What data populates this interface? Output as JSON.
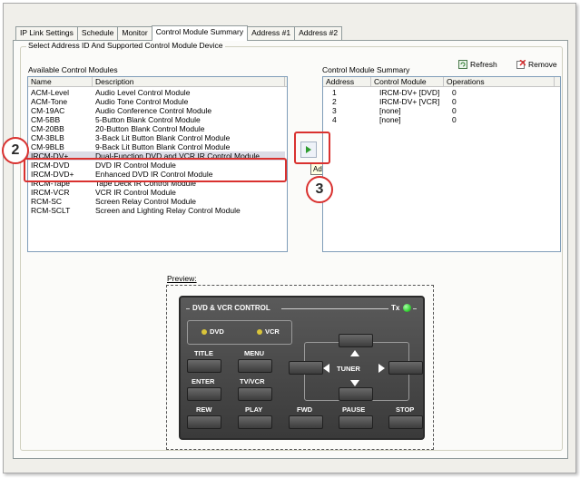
{
  "tabs": [
    "IP Link Settings",
    "Schedule",
    "Monitor",
    "Control Module Summary",
    "Address #1",
    "Address #2"
  ],
  "active_tab": "Control Module Summary",
  "group_title": "Select Address ID And Supported Control Module Device",
  "available": {
    "label": "Available Control Modules",
    "columns": [
      "Name",
      "Description"
    ],
    "rows": [
      [
        "ACM-Level",
        "Audio Level Control Module"
      ],
      [
        "ACM-Tone",
        "Audio Tone Control Module"
      ],
      [
        "CM-19AC",
        "Audio Conference Control Module"
      ],
      [
        "CM-5BB",
        "5-Button Blank Control Module"
      ],
      [
        "CM-20BB",
        "20-Button Blank Control Module"
      ],
      [
        "CM-3BLB",
        "3-Back Lit Button Blank Control Module"
      ],
      [
        "CM-9BLB",
        "9-Back Lit Button Blank Control Module"
      ],
      [
        "IRCM-DV+",
        "Dual-Function DVD and VCR IR Control Module"
      ],
      [
        "IRCM-DVD",
        "DVD IR Control Module"
      ],
      [
        "IRCM-DVD+",
        "Enhanced DVD IR Control Module"
      ],
      [
        "IRCM-Tape",
        "Tape Deck IR Control Module"
      ],
      [
        "IRCM-VCR",
        "VCR IR Control Module"
      ],
      [
        "RCM-SC",
        "Screen Relay Control Module"
      ],
      [
        "RCM-SCLT",
        "Screen and Lighting Relay Control Module"
      ]
    ]
  },
  "add_tooltip": "Add",
  "summary": {
    "label": "Control Module Summary",
    "refresh_label": "Refresh",
    "remove_label": "Remove",
    "columns": [
      "Address",
      "Control Module",
      "Operations"
    ],
    "rows": [
      [
        "1",
        "IRCM-DV+ [DVD]",
        "0"
      ],
      [
        "2",
        "IRCM-DV+ [VCR]",
        "0"
      ],
      [
        "3",
        "[none]",
        "0"
      ],
      [
        "4",
        "[none]",
        "0"
      ]
    ]
  },
  "callouts": [
    "2",
    "3"
  ],
  "preview": {
    "label": "Preview:",
    "panel_title": "DVD & VCR CONTROL",
    "tx_label": "Tx",
    "dvd_label": "DVD",
    "vcr_label": "VCR",
    "tuner_label": "TUNER",
    "buttons": [
      "TITLE",
      "MENU",
      "ENTER",
      "TV/VCR",
      "REW",
      "PLAY",
      "FWD",
      "PAUSE",
      "STOP"
    ]
  },
  "colors": {
    "callout": "#d9312f",
    "led": "#35d335",
    "selection": "#dcdce6"
  }
}
